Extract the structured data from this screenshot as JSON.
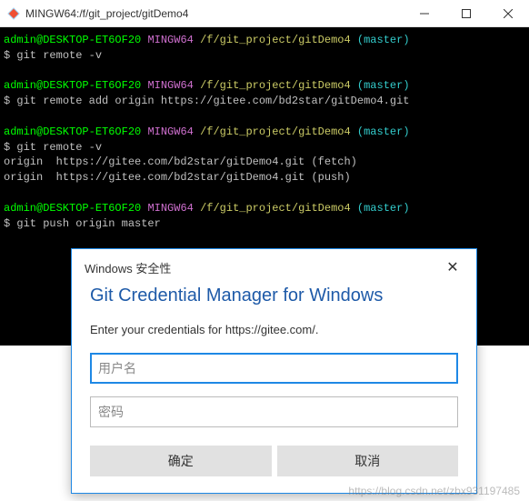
{
  "titlebar": {
    "title": "MINGW64:/f/git_project/gitDemo4"
  },
  "terminal": {
    "prompt_user": "admin@DESKTOP-ET6OF20",
    "prompt_env": "MINGW64",
    "prompt_path": "/f/git_project/gitDemo4",
    "prompt_branch": "(master)",
    "dollar": "$",
    "cmd1": "git remote -v",
    "cmd2": "git remote add origin https://gitee.com/bd2star/gitDemo4.git",
    "cmd3": "git remote -v",
    "out_fetch": "origin  https://gitee.com/bd2star/gitDemo4.git (fetch)",
    "out_push": "origin  https://gitee.com/bd2star/gitDemo4.git (push)",
    "cmd4": "git push origin master"
  },
  "dialog": {
    "security_label": "Windows 安全性",
    "title": "Git Credential Manager for Windows",
    "instruction": "Enter your credentials for https://gitee.com/.",
    "username_placeholder": "用户名",
    "password_placeholder": "密码",
    "ok_label": "确定",
    "cancel_label": "取消"
  },
  "watermark": "https://blog.csdn.net/zbx931197485"
}
